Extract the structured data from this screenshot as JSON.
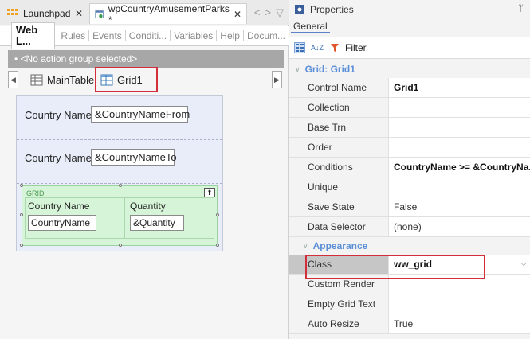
{
  "doc_tabs": {
    "tab1": {
      "label": "Launchpad",
      "close": "✕"
    },
    "tab2": {
      "label": "wpCountryAmusementParks *",
      "close": "✕"
    },
    "nav_left": "<",
    "nav_right": ">",
    "nav_menu": "▽"
  },
  "sub_tabs": [
    "Web L...",
    "Rules",
    "Events",
    "Conditi...",
    "Variables",
    "Help",
    "Docum..."
  ],
  "action_group": "• <No action group selected>",
  "layout_tabs": {
    "scroll_left": "◀",
    "scroll_right": "▶",
    "main_table": "MainTable",
    "grid": "Grid1"
  },
  "form": {
    "row1": {
      "label": "Country Name",
      "variable": "&CountryNameFrom"
    },
    "row2": {
      "label": "Country Name",
      "variable": "&CountryNameTo"
    },
    "grid": {
      "tag": "GRID",
      "col1_header": "Country Name",
      "col1_value": "CountryName",
      "col2_header": "Quantity",
      "col2_value": "&Quantity"
    }
  },
  "properties": {
    "title": "Properties",
    "pin": "ᛘ",
    "tab": "General",
    "filter_label": "Filter",
    "sort_icon_text": "A↓Z",
    "section1": "Grid: Grid1",
    "rows1": [
      {
        "name": "Control Name",
        "value": "Grid1",
        "bold": true
      },
      {
        "name": "Collection",
        "value": ""
      },
      {
        "name": "Base Trn",
        "value": ""
      },
      {
        "name": "Order",
        "value": ""
      },
      {
        "name": "Conditions",
        "value": "CountryName >= &CountryNa...",
        "bold": true
      },
      {
        "name": "Unique",
        "value": ""
      },
      {
        "name": "Save State",
        "value": "False"
      },
      {
        "name": "Data Selector",
        "value": "(none)"
      }
    ],
    "section2": "Appearance",
    "rows2": [
      {
        "name": "Class",
        "value": "ww_grid",
        "bold": true
      },
      {
        "name": "Custom Render",
        "value": ""
      },
      {
        "name": "Empty Grid Text",
        "value": ""
      },
      {
        "name": "Auto Resize",
        "value": "True"
      }
    ],
    "dropdown_arrow": "⌵"
  },
  "colors": {
    "highlight": "#d32f3a",
    "section": "#5b8fd8",
    "grid_bg": "#d6f5d8"
  }
}
